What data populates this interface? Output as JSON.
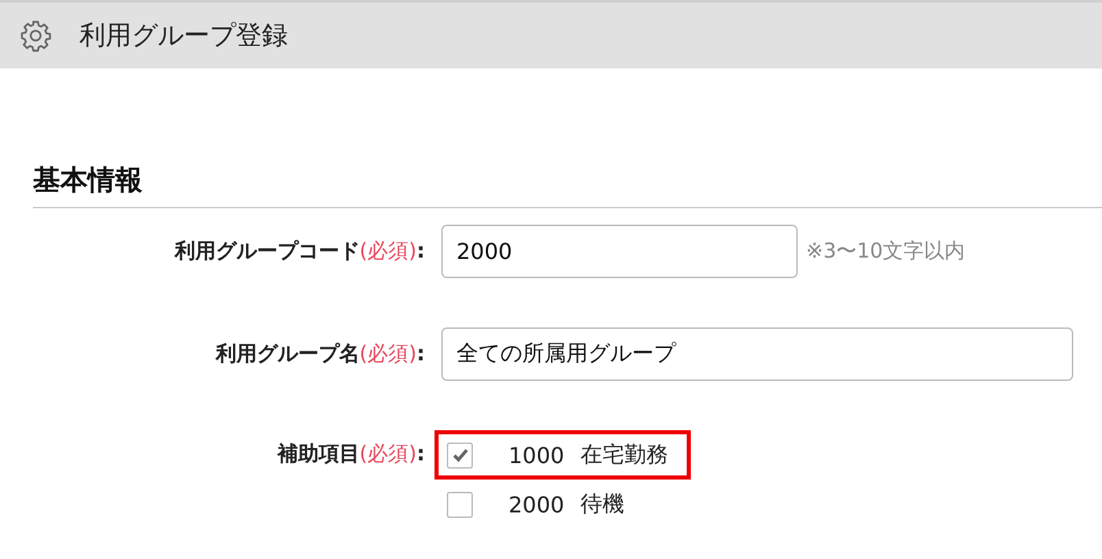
{
  "header": {
    "title": "利用グループ登録"
  },
  "section": {
    "title": "基本情報"
  },
  "fields": [
    {
      "kind": "text",
      "label": "利用グループコード",
      "required": "(必須)",
      "colon": ":",
      "value": "2000",
      "hint": "※3〜10文字以内",
      "wide": false
    },
    {
      "kind": "text",
      "label": "利用グループ名",
      "required": "(必須)",
      "colon": ":",
      "value": "全ての所属用グループ",
      "wide": true
    },
    {
      "kind": "checklist",
      "label": "補助項目",
      "required": "(必須)",
      "colon": ":",
      "options": [
        {
          "code": "1000",
          "name": "在宅勤務",
          "checked": true,
          "highlighted": true
        },
        {
          "code": "2000",
          "name": "待機",
          "checked": false,
          "highlighted": false
        }
      ]
    }
  ]
}
